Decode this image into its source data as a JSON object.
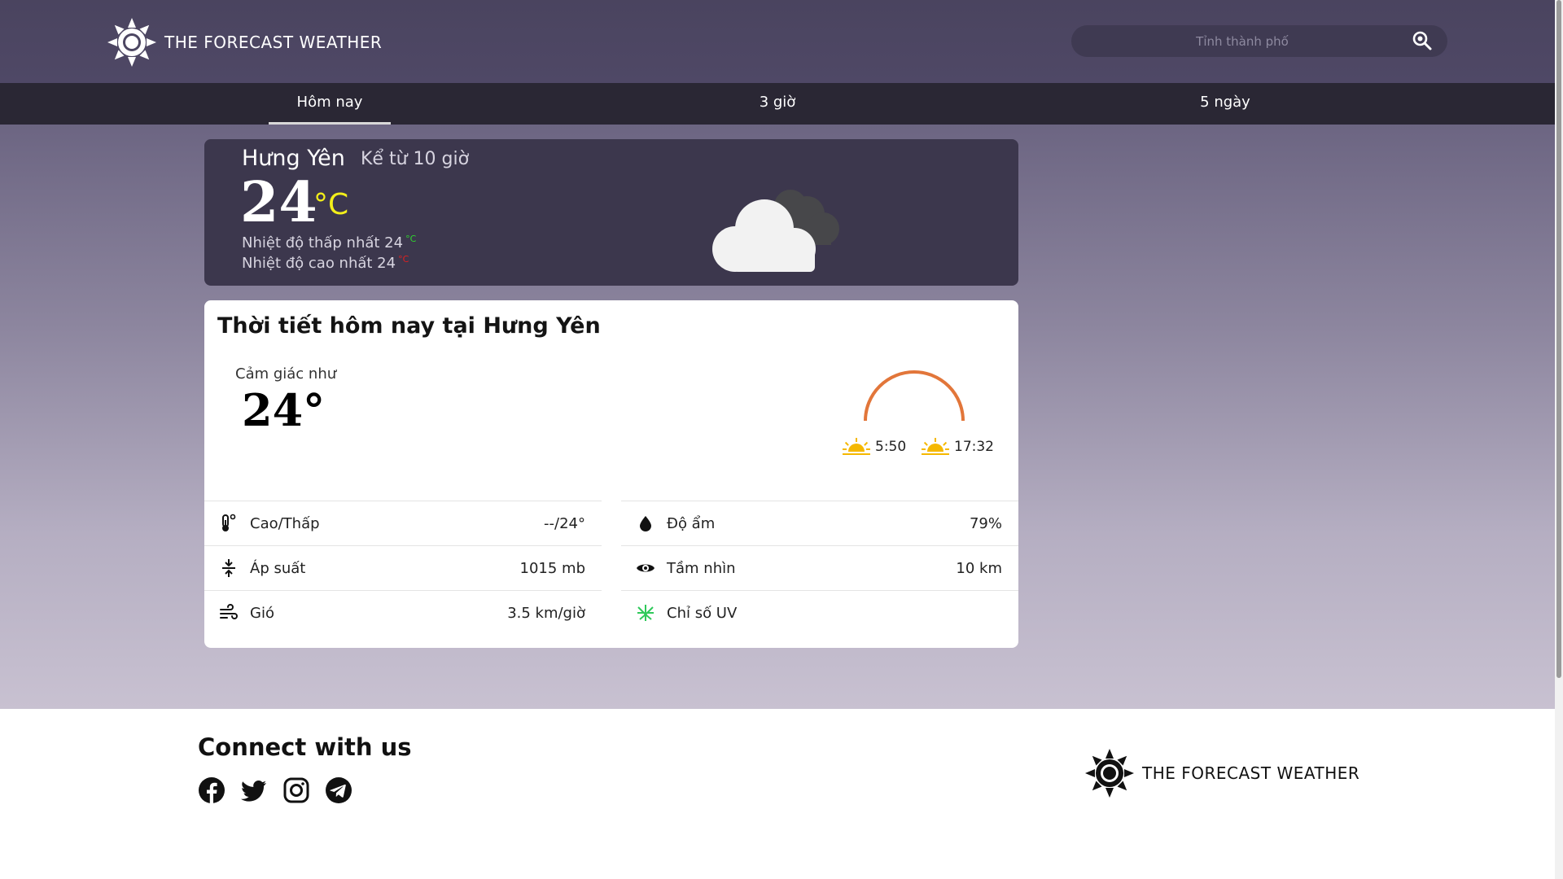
{
  "header": {
    "brand": "THE FORECAST WEATHER",
    "search_placeholder": "Tỉnh thành phố"
  },
  "tabs": [
    {
      "label": "Hôm nay",
      "active": true
    },
    {
      "label": "3 giờ",
      "active": false
    },
    {
      "label": "5 ngày",
      "active": false
    }
  ],
  "current": {
    "city": "Hưng Yên",
    "since": "Kể từ 10 giờ",
    "temp": "24",
    "unit": "°C",
    "min_label": "Nhiệt độ thấp nhất 24",
    "min_unit": "°C",
    "max_label": "Nhiệt độ cao nhất 24",
    "max_unit": "°C",
    "icon": "cloud-icon",
    "colors": {
      "unit": "#f3ef1a",
      "min_unit": "#2ed52e",
      "max_unit": "#e02020"
    }
  },
  "today": {
    "title": "Thời tiết hôm nay tại Hưng Yên",
    "feels_label": "Cảm giác như",
    "feels_value": "24°",
    "sunrise": "5:50",
    "sunset": "17:32",
    "arc_color": "#e2763a",
    "details_left": [
      {
        "icon": "thermometer-icon",
        "label": "Cao/Thấp",
        "value": "--/24°"
      },
      {
        "icon": "pressure-icon",
        "label": "Áp suất",
        "value": "1015 mb"
      },
      {
        "icon": "wind-icon",
        "label": "Gió",
        "value": "3.5 km/giờ"
      }
    ],
    "details_right": [
      {
        "icon": "humidity-icon",
        "label": "Độ ẩm",
        "value": "79%"
      },
      {
        "icon": "eye-icon",
        "label": "Tầm nhìn",
        "value": "10 km"
      },
      {
        "icon": "uv-icon",
        "label": "Chỉ số UV",
        "value": ""
      }
    ]
  },
  "footer": {
    "connect": "Connect with us",
    "socials": [
      "facebook-icon",
      "twitter-icon",
      "instagram-icon",
      "telegram-icon"
    ],
    "brand": "THE FORECAST WEATHER"
  }
}
